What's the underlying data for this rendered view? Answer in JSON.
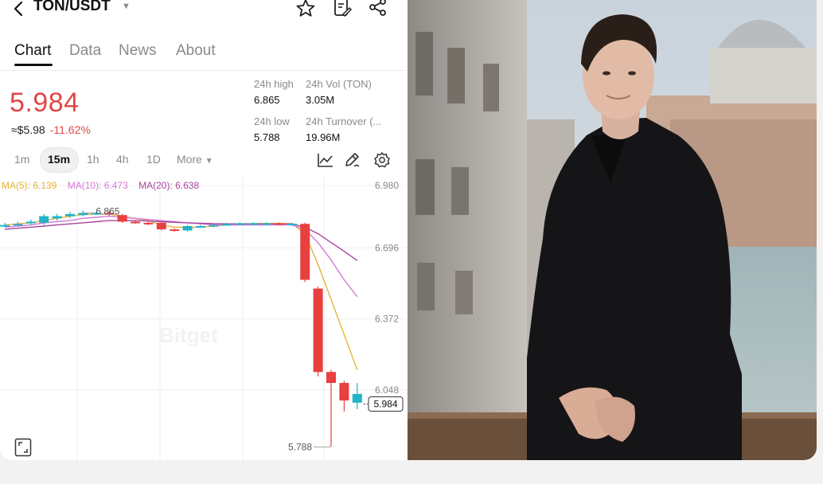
{
  "header": {
    "title": "TON/USDT"
  },
  "tabs": [
    {
      "label": "Chart"
    },
    {
      "label": "Data"
    },
    {
      "label": "News"
    },
    {
      "label": "About"
    }
  ],
  "price": {
    "last": "5.984",
    "fiat": "≈$5.98",
    "change": "-11.62%"
  },
  "stats": {
    "high_label": "24h high",
    "high_value": "6.865",
    "vol_label": "24h Vol (TON)",
    "vol_value": "3.05M",
    "low_label": "24h low",
    "low_value": "5.788",
    "turnover_label": "24h Turnover (...",
    "turnover_value": "19.96M"
  },
  "intervals": {
    "items": [
      "1m",
      "15m",
      "1h",
      "4h",
      "1D"
    ],
    "selected": "15m",
    "more": "More"
  },
  "moving_averages": {
    "ma5": "MA(5): 6.139",
    "ma10": "MA(10): 6.473",
    "ma20": "MA(20): 6.638"
  },
  "chart_data": {
    "type": "candlestick",
    "y_ticks": [
      "6.980",
      "6.696",
      "6.372",
      "6.048"
    ],
    "ylim": [
      5.75,
      6.98
    ],
    "last_price_tag": "5.984",
    "high_marker": "6.865",
    "low_marker": "5.788",
    "watermark": "Bitget",
    "candles": [
      {
        "o": 6.8,
        "c": 6.8,
        "h": 6.81,
        "l": 6.79
      },
      {
        "o": 6.805,
        "c": 6.805,
        "h": 6.815,
        "l": 6.795
      },
      {
        "o": 6.81,
        "c": 6.815,
        "h": 6.825,
        "l": 6.8
      },
      {
        "o": 6.81,
        "c": 6.84,
        "h": 6.85,
        "l": 6.8
      },
      {
        "o": 6.83,
        "c": 6.84,
        "h": 6.85,
        "l": 6.82
      },
      {
        "o": 6.84,
        "c": 6.85,
        "h": 6.86,
        "l": 6.83
      },
      {
        "o": 6.845,
        "c": 6.855,
        "h": 6.865,
        "l": 6.84
      },
      {
        "o": 6.85,
        "c": 6.855,
        "h": 6.86,
        "l": 6.845
      },
      {
        "o": 6.855,
        "c": 6.85,
        "h": 6.865,
        "l": 6.84
      },
      {
        "o": 6.845,
        "c": 6.815,
        "h": 6.85,
        "l": 6.81
      },
      {
        "o": 6.815,
        "c": 6.81,
        "h": 6.82,
        "l": 6.805
      },
      {
        "o": 6.81,
        "c": 6.808,
        "h": 6.815,
        "l": 6.8
      },
      {
        "o": 6.81,
        "c": 6.78,
        "h": 6.812,
        "l": 6.775
      },
      {
        "o": 6.78,
        "c": 6.775,
        "h": 6.785,
        "l": 6.77
      },
      {
        "o": 6.775,
        "c": 6.795,
        "h": 6.8,
        "l": 6.77
      },
      {
        "o": 6.795,
        "c": 6.795,
        "h": 6.8,
        "l": 6.79
      },
      {
        "o": 6.795,
        "c": 6.8,
        "h": 6.805,
        "l": 6.79
      },
      {
        "o": 6.8,
        "c": 6.805,
        "h": 6.81,
        "l": 6.795
      },
      {
        "o": 6.805,
        "c": 6.808,
        "h": 6.812,
        "l": 6.8
      },
      {
        "o": 6.808,
        "c": 6.808,
        "h": 6.812,
        "l": 6.805
      },
      {
        "o": 6.808,
        "c": 6.808,
        "h": 6.812,
        "l": 6.805
      },
      {
        "o": 6.808,
        "c": 6.807,
        "h": 6.812,
        "l": 6.804
      },
      {
        "o": 6.806,
        "c": 6.806,
        "h": 6.81,
        "l": 6.803
      },
      {
        "o": 6.805,
        "c": 6.55,
        "h": 6.81,
        "l": 6.54
      },
      {
        "o": 6.51,
        "c": 6.13,
        "h": 6.52,
        "l": 6.11
      },
      {
        "o": 6.13,
        "c": 6.08,
        "h": 6.14,
        "l": 5.79
      },
      {
        "o": 6.08,
        "c": 6.0,
        "h": 6.09,
        "l": 5.95
      },
      {
        "o": 5.99,
        "c": 6.03,
        "h": 6.08,
        "l": 5.96
      }
    ],
    "ma5": [
      6.8,
      6.805,
      6.81,
      6.82,
      6.83,
      6.84,
      6.848,
      6.85,
      6.85,
      6.84,
      6.83,
      6.82,
      6.8,
      6.79,
      6.79,
      6.79,
      6.795,
      6.8,
      6.805,
      6.806,
      6.807,
      6.807,
      6.806,
      6.76,
      6.62,
      6.46,
      6.3,
      6.139
    ],
    "ma10": [
      6.79,
      6.795,
      6.8,
      6.81,
      6.815,
      6.82,
      6.83,
      6.835,
      6.84,
      6.835,
      6.83,
      6.825,
      6.82,
      6.815,
      6.81,
      6.805,
      6.8,
      6.8,
      6.8,
      6.8,
      6.8,
      6.8,
      6.8,
      6.78,
      6.72,
      6.64,
      6.55,
      6.473
    ],
    "ma20": [
      6.78,
      6.785,
      6.79,
      6.795,
      6.8,
      6.805,
      6.81,
      6.815,
      6.82,
      6.82,
      6.82,
      6.818,
      6.815,
      6.812,
      6.81,
      6.808,
      6.806,
      6.805,
      6.805,
      6.805,
      6.805,
      6.805,
      6.805,
      6.79,
      6.76,
      6.72,
      6.68,
      6.638
    ]
  },
  "colors": {
    "up": "#22b3c7",
    "down": "#e83f3f",
    "ma5": "#e8b33a",
    "ma10": "#d37ad8",
    "ma20": "#a8459c"
  }
}
